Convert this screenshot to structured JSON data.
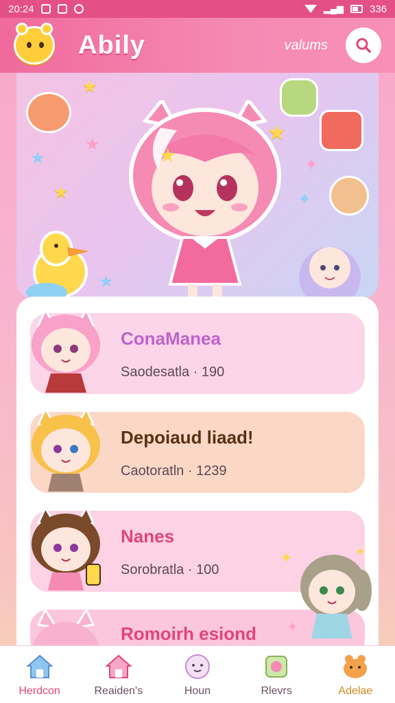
{
  "status_bar": {
    "time": "20:24",
    "right_text": "336"
  },
  "header": {
    "title": "Abily",
    "link": "valums",
    "search_icon": "search-icon"
  },
  "cards": [
    {
      "title": "ConaManea",
      "subtitle": "Saodesatla · 190"
    },
    {
      "title": "Depoiaud liaad!",
      "subtitle": "Caotoratln · 1239"
    },
    {
      "title": "Nanes",
      "subtitle": "Sorobratla · 100"
    },
    {
      "title": "Romoirh esiond"
    }
  ],
  "nav": [
    {
      "label": "Herdcon",
      "icon": "home-icon"
    },
    {
      "label": "Reaiden's",
      "icon": "house-icon"
    },
    {
      "label": "Houn",
      "icon": "face-icon"
    },
    {
      "label": "Rlevrs",
      "icon": "sticker-icon"
    },
    {
      "label": "Adelae",
      "icon": "mascot-icon"
    }
  ],
  "colors": {
    "accent": "#e44f86",
    "header": "#f06a9c",
    "active": "#e0447c"
  }
}
